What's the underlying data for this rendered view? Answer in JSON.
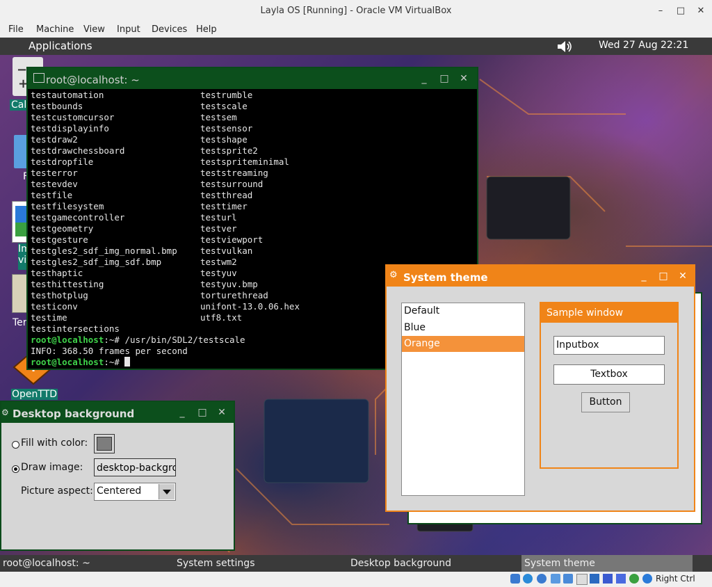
{
  "host": {
    "title": "Layla OS [Running] - Oracle VM VirtualBox",
    "menu": [
      "File",
      "Machine",
      "View",
      "Input",
      "Devices",
      "Help"
    ],
    "host_key": "Right Ctrl"
  },
  "guest": {
    "panel": {
      "applications": "Applications",
      "clock": "Wed 27 Aug 22:21"
    },
    "desktop_icons": [
      {
        "label": "Calc",
        "icon": "calculator-icon"
      },
      {
        "label": "F",
        "icon": "file-manager-icon"
      },
      {
        "label": "Im vie",
        "icon": "image-viewer-icon"
      },
      {
        "label": "Ter",
        "icon": "terminal-icon"
      },
      {
        "label": "OpenTTD",
        "icon": "openttd-icon"
      }
    ],
    "terminal": {
      "title": "root@localhost: ~",
      "rows": [
        [
          "testautomation",
          "testrumble"
        ],
        [
          "testbounds",
          "testscale"
        ],
        [
          "testcustomcursor",
          "testsem"
        ],
        [
          "testdisplayinfo",
          "testsensor"
        ],
        [
          "testdraw2",
          "testshape"
        ],
        [
          "testdrawchessboard",
          "testsprite2"
        ],
        [
          "testdropfile",
          "testspriteminimal"
        ],
        [
          "testerror",
          "teststreaming"
        ],
        [
          "testevdev",
          "testsurround"
        ],
        [
          "testfile",
          "testthread"
        ],
        [
          "testfilesystem",
          "testtimer"
        ],
        [
          "testgamecontroller",
          "testurl"
        ],
        [
          "testgeometry",
          "testver"
        ],
        [
          "testgesture",
          "testviewport"
        ],
        [
          "testgles2_sdf_img_normal.bmp",
          "testvulkan"
        ],
        [
          "testgles2_sdf_img_sdf.bmp",
          "testwm2"
        ],
        [
          "testhaptic",
          "testyuv"
        ],
        [
          "testhittesting",
          "testyuv.bmp"
        ],
        [
          "testhotplug",
          "torturethread"
        ],
        [
          "testiconv",
          "unifont-13.0.06.hex"
        ],
        [
          "testime",
          "utf8.txt"
        ],
        [
          "testintersections",
          ""
        ]
      ],
      "prompt_user": "root@localhost",
      "prompt_path": ":~# ",
      "command": "/usr/bin/SDL2/testscale",
      "output": "INFO: 368.50 frames per second"
    },
    "desktop_background": {
      "title": "Desktop background",
      "fill_label": "Fill with color:",
      "draw_label": "Draw image:",
      "image_value": "desktop-backgrou",
      "aspect_label": "Picture aspect:",
      "aspect_value": "Centered",
      "swatch_color": "#7d7d7d"
    },
    "system_theme": {
      "title": "System theme",
      "themes": [
        "Default",
        "Blue",
        "Orange"
      ],
      "selected": "Orange",
      "sample_title": "Sample window",
      "inputbox": "Inputbox",
      "textbox": "Textbox",
      "button": "Button",
      "accent": "#f08418"
    },
    "taskbar": [
      "root@localhost: ~",
      "System settings",
      "Desktop background",
      "System theme"
    ]
  }
}
